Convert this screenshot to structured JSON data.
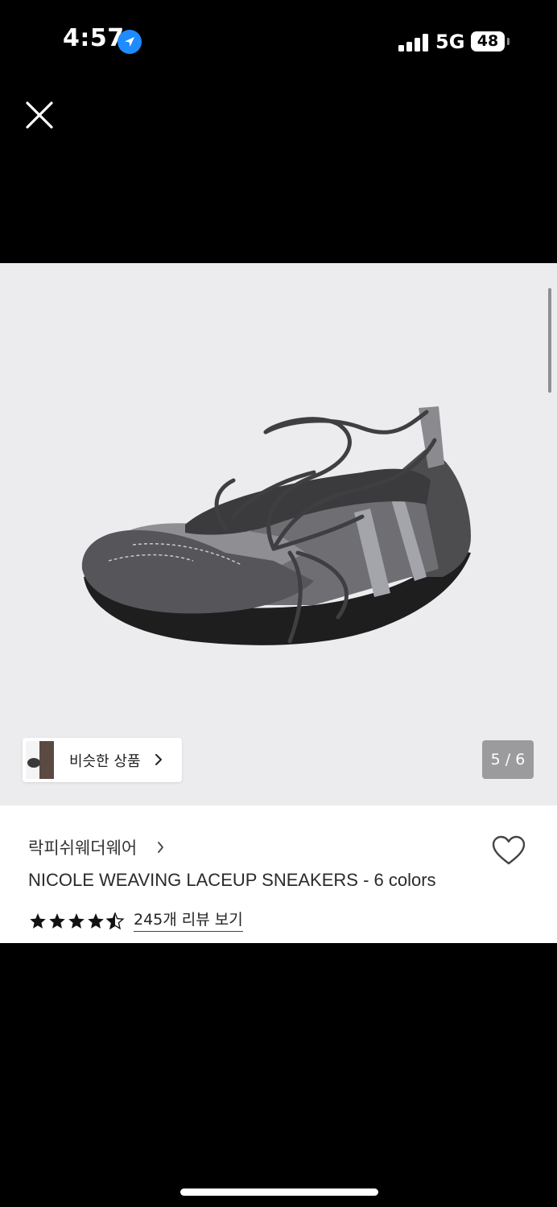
{
  "status_bar": {
    "time": "4:57",
    "network": "5G",
    "battery_level": "48"
  },
  "icons": {
    "close": "close-icon",
    "location": "location-arrow-icon",
    "signal": "signal-bars-icon",
    "battery": "battery-icon",
    "chevron": "chevron-right-icon",
    "favorite": "heart-outline-icon",
    "star": "star-icon"
  },
  "gallery": {
    "similar_products_label": "비슷한 상품",
    "page_counter": "5 / 6"
  },
  "product": {
    "brand": "락피쉬웨더웨어",
    "title": "NICOLE WEAVING LACEUP SNEAKERS - 6 colors",
    "rating": 4.5,
    "review_link": "245개 리뷰 보기"
  },
  "colors": {
    "background": "#000000",
    "image_background": "#ececee",
    "location_accent": "#1e8cff",
    "page_counter_bg": "#9b9b9d"
  }
}
